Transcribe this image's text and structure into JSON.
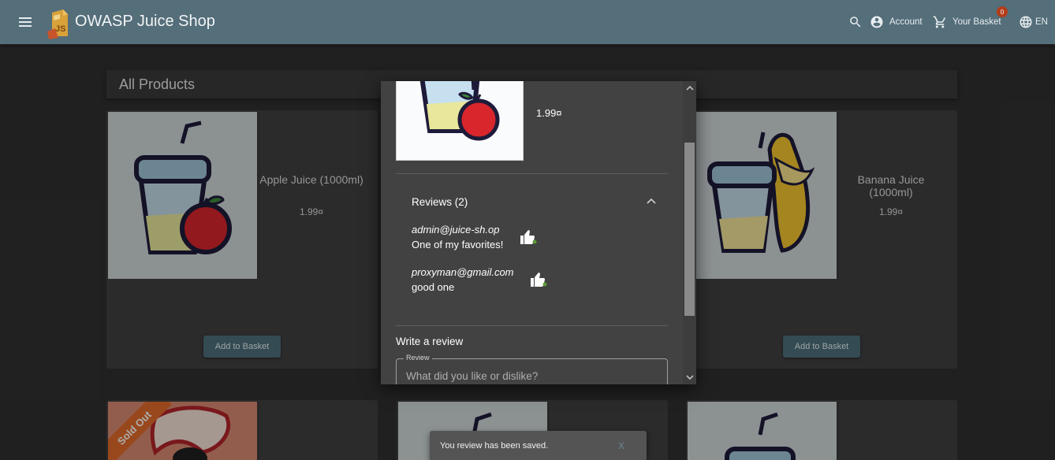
{
  "app": {
    "title": "OWASP Juice Shop",
    "logo_text": "JS"
  },
  "toolbar": {
    "account_label": "Account",
    "basket_label": "Your Basket",
    "basket_count": "0",
    "language_label": "EN"
  },
  "page": {
    "title": "All Products"
  },
  "products": [
    {
      "name": "Apple Juice (1000ml)",
      "price": "1.99¤",
      "button": "Add to Basket"
    },
    {
      "name": "Banana Juice (1000ml)",
      "price": "1.99¤",
      "button": "Add to Basket"
    }
  ],
  "sold_out_label": "Sold Out",
  "dialog": {
    "price": "1.99¤",
    "reviews_title": "Reviews (2)",
    "reviews": [
      {
        "author": "admin@juice-sh.op",
        "text": "One of my favorites!"
      },
      {
        "author": "proxyman@gmail.com",
        "text": "good one"
      }
    ],
    "write_title": "Write a review",
    "review_label": "Review",
    "review_placeholder": "What did you like or dislike?"
  },
  "snackbar": {
    "message": "You review has been saved.",
    "close_label": "X"
  },
  "colors": {
    "toolbar": "#546e7a",
    "background": "#303030",
    "card": "#404040",
    "dialog": "#424242",
    "button": "#4d6f7b",
    "badge": "#b33d1a",
    "sold_out": "#e06a2a"
  }
}
